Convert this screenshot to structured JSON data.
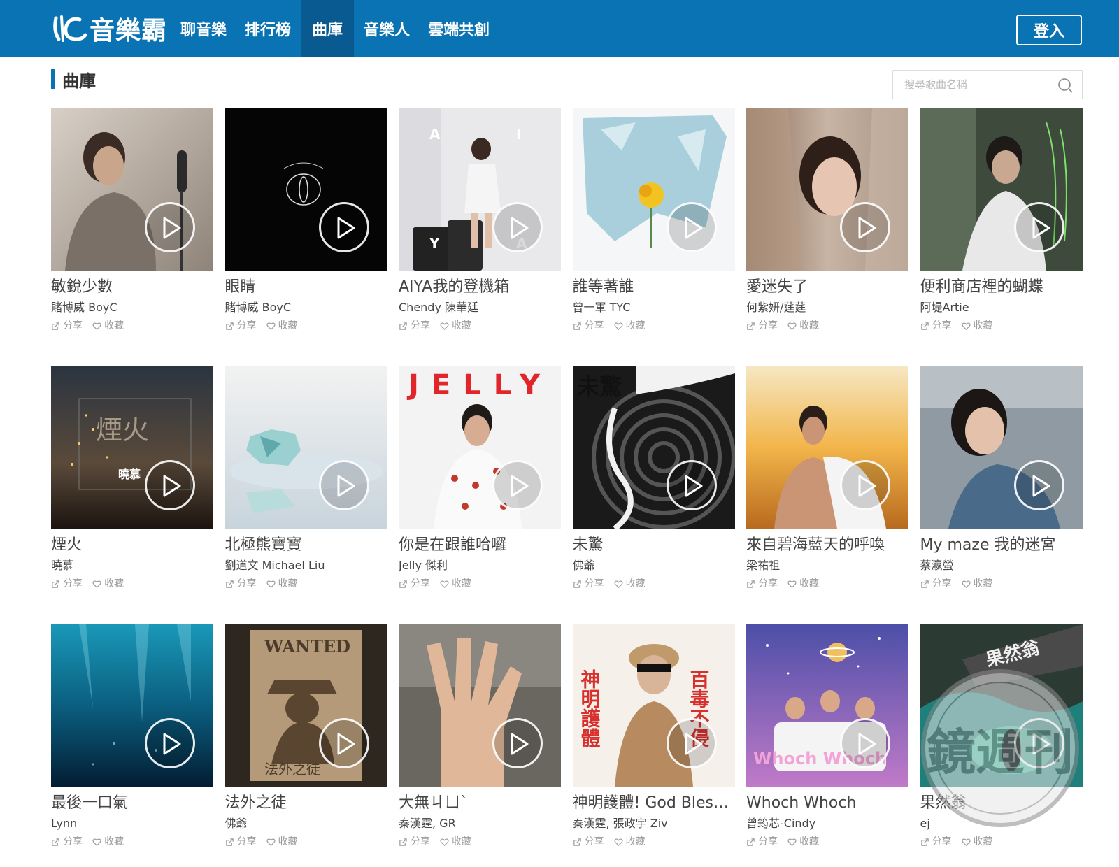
{
  "header": {
    "logo_text": "音樂霸",
    "nav": [
      "聊音樂",
      "排行榜",
      "曲庫",
      "音樂人",
      "雲端共創"
    ],
    "active_nav": "曲庫",
    "login_label": "登入"
  },
  "section": {
    "title": "曲庫",
    "search_placeholder": "搜尋歌曲名稱"
  },
  "action_labels": {
    "share": "分享",
    "favorite": "收藏"
  },
  "songs": [
    {
      "title": "敏銳少數",
      "artist": "賭博威 BoyC"
    },
    {
      "title": "眼睛",
      "artist": "賭博威 BoyC"
    },
    {
      "title": "AIYA我的登機箱",
      "artist": "Chendy 陳華廷"
    },
    {
      "title": "誰等著誰",
      "artist": "曾一軍 TYC"
    },
    {
      "title": "愛迷失了",
      "artist": "何紫妍/莛莛"
    },
    {
      "title": "便利商店裡的蝴蝶",
      "artist": "阿堤Artie"
    },
    {
      "title": "煙火",
      "artist": "曉慕"
    },
    {
      "title": "北極熊寶寶",
      "artist": "劉道文 Michael Liu"
    },
    {
      "title": "你是在跟誰哈囉",
      "artist": "Jelly 傑利"
    },
    {
      "title": "未驚",
      "artist": "佛爺"
    },
    {
      "title": "來自碧海藍天的呼喚",
      "artist": "梁祐祖"
    },
    {
      "title": "My maze 我的迷宮",
      "artist": "蔡瀛螢"
    },
    {
      "title": "最後一口氣",
      "artist": "Lynn"
    },
    {
      "title": "法外之徒",
      "artist": "佛爺"
    },
    {
      "title": "大無ㄐㄩˋ",
      "artist": "秦漢霆, GR"
    },
    {
      "title": "神明護體! God Bless...",
      "artist": "秦漢霆, 張政宇 Ziv"
    },
    {
      "title": "Whoch Whoch",
      "artist": "曾筠芯-Cindy"
    },
    {
      "title": "果然翁",
      "artist": "ej"
    }
  ],
  "cover_text": {
    "aiya_letters": [
      "A",
      "I",
      "Y",
      "A"
    ],
    "jelly": "JELLY",
    "weijing": "未驚",
    "wanted": "WANTED",
    "wanted_sub": "法外之徒",
    "shenming_left": "神明護體",
    "shenming_right": "百毒不侵",
    "yanhuo": "煙火",
    "xiaomu": "曉慕",
    "guoran": "果然翁",
    "whoch": "Whoch Whoch"
  },
  "watermark_text": "鏡週刊",
  "colors": {
    "brand": "#0a73b4",
    "nav_active": "#085a90"
  }
}
